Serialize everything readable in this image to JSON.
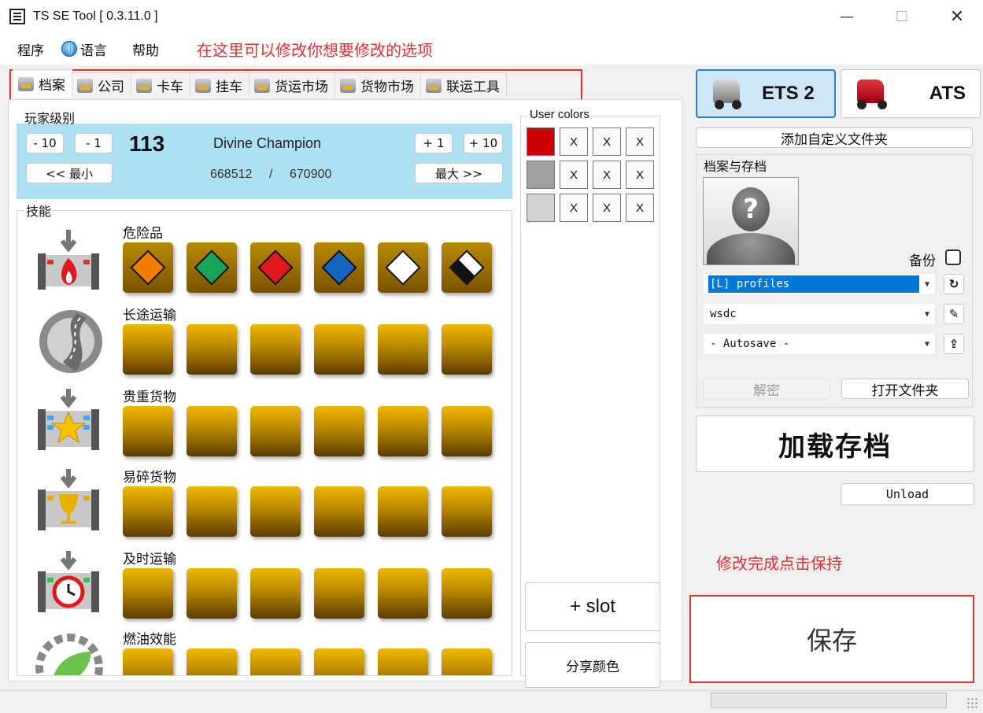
{
  "window": {
    "title": "TS SE Tool [ 0.3.11.0 ]",
    "min": "—",
    "max": "☐",
    "close": "✕"
  },
  "menu": {
    "items": [
      "程序",
      "语言",
      "帮助"
    ]
  },
  "annotations": {
    "top": "在这里可以修改你想要修改的选项",
    "save_hint": "修改完成点击保持"
  },
  "tabs": [
    "档案",
    "公司",
    "卡车",
    "挂车",
    "货运市场",
    "货物市场",
    "联运工具"
  ],
  "player_level": {
    "group_label": "玩家级别",
    "minus10": "- 10",
    "minus1": "- 1",
    "plus1": "+ 1",
    "plus10": "+ 10",
    "min_btn": "<< 最小",
    "max_btn": "最大 >>",
    "level": "113",
    "rank_name": "Divine Champion",
    "xp_current": "668512",
    "xp_sep": "/",
    "xp_next": "670900"
  },
  "skills": {
    "group_label": "技能",
    "items": [
      {
        "name": "危险品",
        "level": 6
      },
      {
        "name": "长途运输",
        "level": 6
      },
      {
        "name": "贵重货物",
        "level": 6
      },
      {
        "name": "易碎货物",
        "level": 6
      },
      {
        "name": "及时运输",
        "level": 6
      },
      {
        "name": "燃油效能",
        "level": 6
      }
    ],
    "hazmat_colors": [
      "#f07c00",
      "#1aa35a",
      "#e0191e",
      "#1565c0",
      "#ffffff",
      "#ffffff"
    ]
  },
  "user_colors": {
    "group_label": "User colors",
    "swatches": [
      "#cc0000",
      "#a0a0a0",
      "#d3d3d3"
    ],
    "x_label": "X",
    "slot_btn": "+ slot",
    "share_btn": "分享颜色"
  },
  "games": [
    {
      "label": "ETS 2",
      "active": true,
      "color": "#b5b5b5"
    },
    {
      "label": "ATS",
      "active": false,
      "color": "#c8102e"
    }
  ],
  "add_folder_btn": "添加自定义文件夹",
  "profiles": {
    "group_label": "档案与存档",
    "avatar_glyph": "?",
    "backup_label": "备份",
    "folder_combo": "[L] profiles",
    "profile_combo": "wsdc",
    "save_combo": "- Autosave -",
    "refresh_icon": "↻",
    "edit_icon": "✎",
    "upload_icon": "⇪",
    "decrypt_btn": "解密",
    "open_folder_btn": "打开文件夹"
  },
  "load_btn": "加载存档",
  "unload_btn": "Unload",
  "save_btn": "保存"
}
